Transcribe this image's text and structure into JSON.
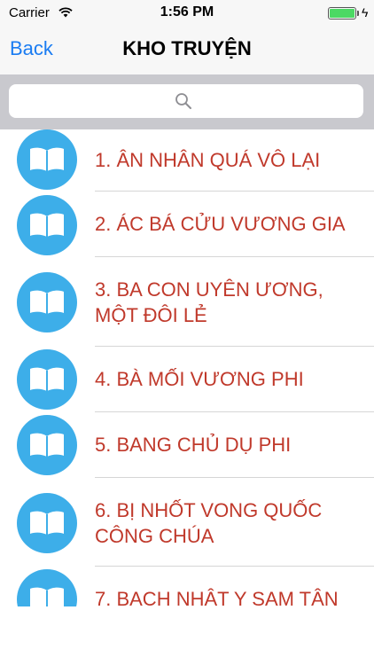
{
  "status_bar": {
    "carrier": "Carrier",
    "time": "1:56 PM",
    "battery_level": 1.0
  },
  "nav": {
    "back_label": "Back",
    "title": "KHO TRUYỆN"
  },
  "search": {
    "placeholder": "",
    "value": ""
  },
  "colors": {
    "accent": "#1a7cf2",
    "item_text": "#c0392b",
    "icon_circle": "#3daee9",
    "search_bar_bg": "#c9c9ce"
  },
  "items": [
    {
      "label": "1. ÂN NHÂN QUÁ VÔ LẠI",
      "icon": "open-book-icon"
    },
    {
      "label": "2. ÁC BÁ CỬU VƯƠNG GIA",
      "icon": "open-book-icon"
    },
    {
      "label": "3. BA CON UYÊN ƯƠNG, MỘT ĐÔI LẺ",
      "icon": "open-book-icon"
    },
    {
      "label": "4. BÀ MỐI VƯƠNG PHI",
      "icon": "open-book-icon"
    },
    {
      "label": "5. BANG CHỦ DỤ PHI",
      "icon": "open-book-icon"
    },
    {
      "label": "6. BỊ NHỐT VONG QUỐC CÔNG CHÚA",
      "icon": "open-book-icon"
    },
    {
      "label": "7. BẠCH NHẬT Y SAM TÂN",
      "icon": "open-book-icon"
    }
  ]
}
